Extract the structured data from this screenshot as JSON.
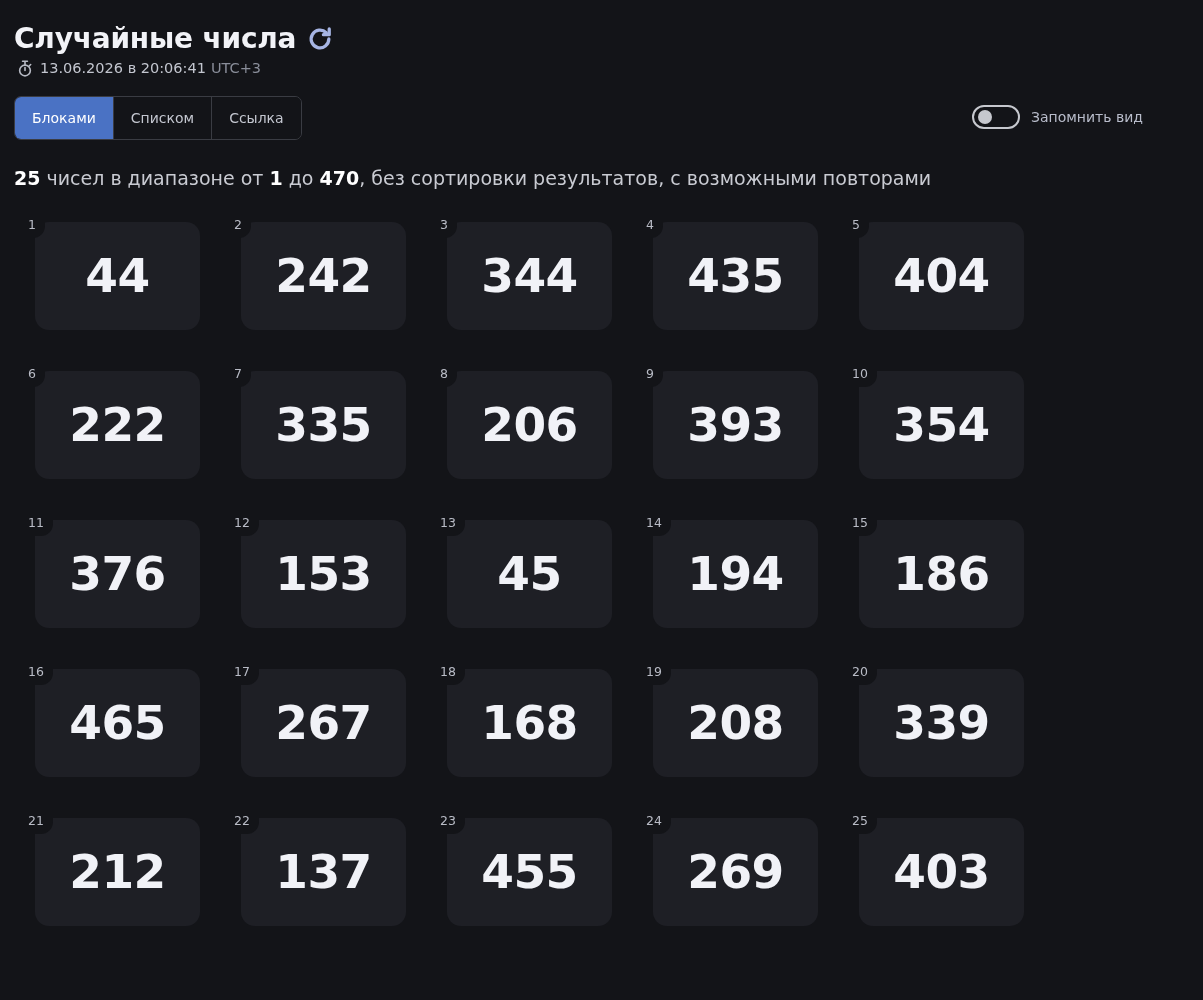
{
  "header": {
    "title": "Случайные числа",
    "timestamp": "13.06.2026 в 20:06:41",
    "timezone": "UTC+3"
  },
  "view_tabs": [
    {
      "label": "Блоками",
      "selected": true
    },
    {
      "label": "Списком",
      "selected": false
    },
    {
      "label": "Ссылка",
      "selected": false
    }
  ],
  "remember_view": {
    "label": "Запомнить вид",
    "on": false
  },
  "summary": "**25** чисел в диапазоне от **1** до **470**, без сортировки результатов, с возможными повторами",
  "numbers": [
    {
      "index": "1",
      "value": "44"
    },
    {
      "index": "2",
      "value": "242"
    },
    {
      "index": "3",
      "value": "344"
    },
    {
      "index": "4",
      "value": "435"
    },
    {
      "index": "5",
      "value": "404"
    },
    {
      "index": "6",
      "value": "222"
    },
    {
      "index": "7",
      "value": "335"
    },
    {
      "index": "8",
      "value": "206"
    },
    {
      "index": "9",
      "value": "393"
    },
    {
      "index": "10",
      "value": "354"
    },
    {
      "index": "11",
      "value": "376"
    },
    {
      "index": "12",
      "value": "153"
    },
    {
      "index": "13",
      "value": "45"
    },
    {
      "index": "14",
      "value": "194"
    },
    {
      "index": "15",
      "value": "186"
    },
    {
      "index": "16",
      "value": "465"
    },
    {
      "index": "17",
      "value": "267"
    },
    {
      "index": "18",
      "value": "168"
    },
    {
      "index": "19",
      "value": "208"
    },
    {
      "index": "20",
      "value": "339"
    },
    {
      "index": "21",
      "value": "212"
    },
    {
      "index": "22",
      "value": "137"
    },
    {
      "index": "23",
      "value": "455"
    },
    {
      "index": "24",
      "value": "269"
    },
    {
      "index": "25",
      "value": "403"
    }
  ]
}
